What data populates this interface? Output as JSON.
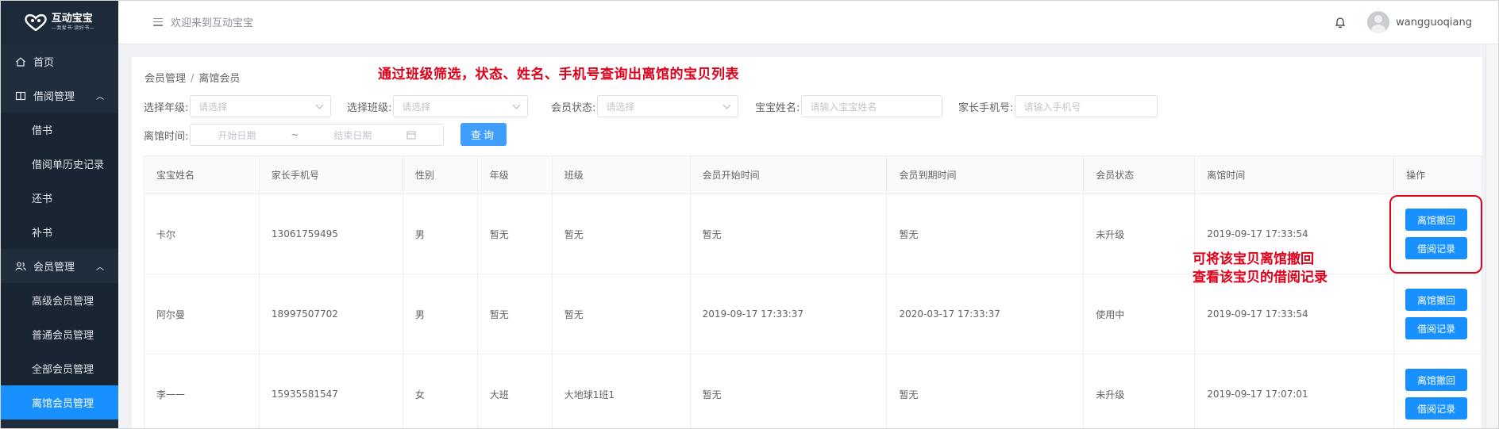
{
  "app": {
    "logo_name": "互动宝宝",
    "logo_slogan": "—我爱书·读好书—"
  },
  "sidebar": {
    "items": [
      {
        "label": "首页",
        "icon": "home-icon"
      },
      {
        "label": "借阅管理",
        "icon": "book-icon",
        "expanded": true,
        "children": [
          "借书",
          "借阅单历史记录",
          "还书",
          "补书"
        ]
      },
      {
        "label": "会员管理",
        "icon": "users-icon",
        "expanded": true,
        "children": [
          "高级会员管理",
          "普通会员管理",
          "全部会员管理",
          "离馆会员管理"
        ]
      }
    ],
    "active": "离馆会员管理"
  },
  "header": {
    "title": "欢迎来到互动宝宝",
    "username": "wangguoqiang"
  },
  "breadcrumb": {
    "parent": "会员管理",
    "sep": "/",
    "current": "离馆会员"
  },
  "annotations": {
    "top": "通过班级筛选，状态、姓名、手机号查询出离馆的宝贝列表",
    "right_line1": "可将该宝贝离馆撤回",
    "right_line2": "查看该宝贝的借阅记录"
  },
  "filters": {
    "grade_label": "选择年级:",
    "grade_placeholder": "请选择",
    "class_label": "选择班级:",
    "class_placeholder": "请选择",
    "status_label": "会员状态:",
    "status_placeholder": "请选择",
    "name_label": "宝宝姓名:",
    "name_placeholder": "请输入宝宝姓名",
    "phone_label": "家长手机号:",
    "phone_placeholder": "请输入手机号",
    "leave_label": "离馆时间:",
    "start_placeholder": "开始日期",
    "range_sep": "~",
    "end_placeholder": "结束日期",
    "query_button": "查询"
  },
  "table": {
    "columns": [
      "宝宝姓名",
      "家长手机号",
      "性别",
      "年级",
      "班级",
      "会员开始时间",
      "会员到期时间",
      "会员状态",
      "离馆时间",
      "操作"
    ],
    "rows": [
      [
        "卡尔",
        "13061759495",
        "男",
        "暂无",
        "暂无",
        "暂无",
        "暂无",
        "未升级",
        "2019-09-17 17:33:54"
      ],
      [
        "阿尔曼",
        "18997507702",
        "男",
        "暂无",
        "暂无",
        "2019-09-17 17:33:37",
        "2020-03-17 17:33:37",
        "使用中",
        "2019-09-17 17:33:54"
      ],
      [
        "李一一",
        "15935581547",
        "女",
        "大班",
        "大地球1班1",
        "暂无",
        "暂无",
        "未升级",
        "2019-09-17 17:07:01"
      ]
    ],
    "op_revoke": "离馆撤回",
    "op_history": "借阅记录"
  },
  "colors": {
    "sidebar_bg": "#1f2d3d",
    "active": "#1890ff",
    "annotation": "#e0001a"
  }
}
